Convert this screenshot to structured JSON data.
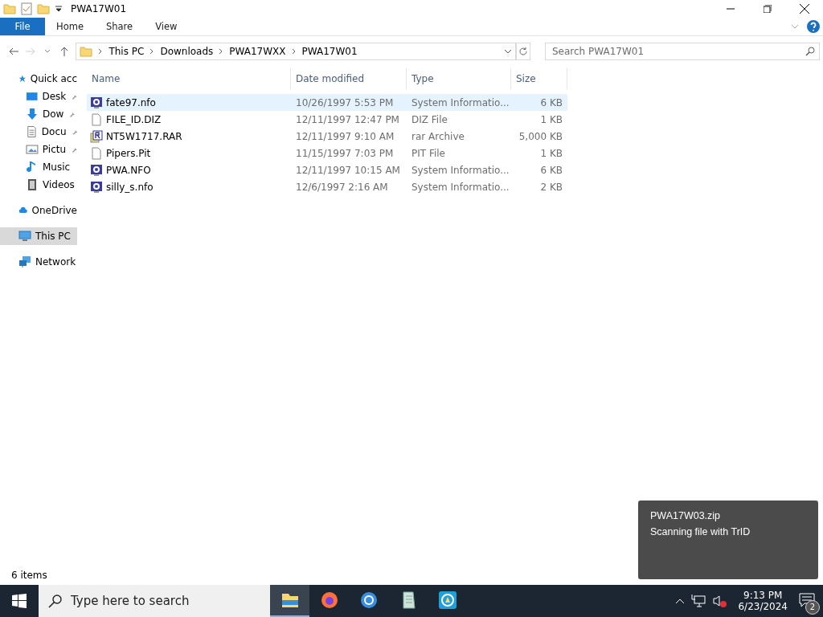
{
  "window": {
    "title": "PWA17W01"
  },
  "ribbon_tabs": [
    {
      "label": "File",
      "selected": true
    },
    {
      "label": "Home",
      "selected": false
    },
    {
      "label": "Share",
      "selected": false
    },
    {
      "label": "View",
      "selected": false
    }
  ],
  "address": {
    "crumbs": [
      "This PC",
      "Downloads",
      "PWA17WXX",
      "PWA17W01"
    ]
  },
  "search": {
    "placeholder": "Search PWA17W01"
  },
  "nav": [
    {
      "label": "Quick acc",
      "kind": "star",
      "pinned": false,
      "selected": false,
      "indent": false
    },
    {
      "label": "Desk",
      "kind": "desktop",
      "pinned": true,
      "selected": false,
      "indent": true
    },
    {
      "label": "Dow",
      "kind": "download",
      "pinned": true,
      "selected": false,
      "indent": true
    },
    {
      "label": "Docu",
      "kind": "document",
      "pinned": true,
      "selected": false,
      "indent": true
    },
    {
      "label": "Pictu",
      "kind": "picture",
      "pinned": true,
      "selected": false,
      "indent": true
    },
    {
      "label": "Music",
      "kind": "music",
      "pinned": false,
      "selected": false,
      "indent": true
    },
    {
      "label": "Videos",
      "kind": "video",
      "pinned": false,
      "selected": false,
      "indent": true
    },
    {
      "label": "OneDrive",
      "kind": "cloud",
      "pinned": false,
      "selected": false,
      "indent": false
    },
    {
      "label": "This PC",
      "kind": "pc",
      "pinned": false,
      "selected": true,
      "indent": false
    },
    {
      "label": "Network",
      "kind": "network",
      "pinned": false,
      "selected": false,
      "indent": false
    }
  ],
  "table": {
    "columns": [
      "Name",
      "Date modified",
      "Type",
      "Size"
    ],
    "rows": [
      {
        "name": "fate97.nfo",
        "date": "10/26/1997 5:53 PM",
        "type": "System Informatio...",
        "size": "6 KB",
        "kind": "info",
        "selected": true
      },
      {
        "name": "FILE_ID.DIZ",
        "date": "12/11/1997 12:47 PM",
        "type": "DIZ File",
        "size": "1 KB",
        "kind": "blank",
        "selected": false
      },
      {
        "name": "NT5W1717.RAR",
        "date": "12/11/1997 9:10 AM",
        "type": "rar Archive",
        "size": "5,000 KB",
        "kind": "archive",
        "selected": false
      },
      {
        "name": "Pipers.Pit",
        "date": "11/15/1997 7:03 PM",
        "type": "PIT File",
        "size": "1 KB",
        "kind": "blank",
        "selected": false
      },
      {
        "name": "PWA.NFO",
        "date": "12/11/1997 10:15 AM",
        "type": "System Informatio...",
        "size": "6 KB",
        "kind": "info",
        "selected": false
      },
      {
        "name": "silly_s.nfo",
        "date": "12/6/1997 2:16 AM",
        "type": "System Informatio...",
        "size": "2 KB",
        "kind": "info",
        "selected": false
      }
    ]
  },
  "status_bar": "6 items",
  "toast": {
    "title": "PWA17W03.zip",
    "message": "Scanning file with TrID"
  },
  "taskbar": {
    "search_placeholder": "Type here to search",
    "apps": [
      {
        "kind": "folder",
        "selected": true
      },
      {
        "kind": "fox",
        "selected": false
      },
      {
        "kind": "browser",
        "selected": false
      },
      {
        "kind": "notepad",
        "selected": false
      },
      {
        "kind": "app",
        "selected": false
      }
    ],
    "time": "9:13 PM",
    "date": "6/23/2024",
    "notifications": "2"
  }
}
